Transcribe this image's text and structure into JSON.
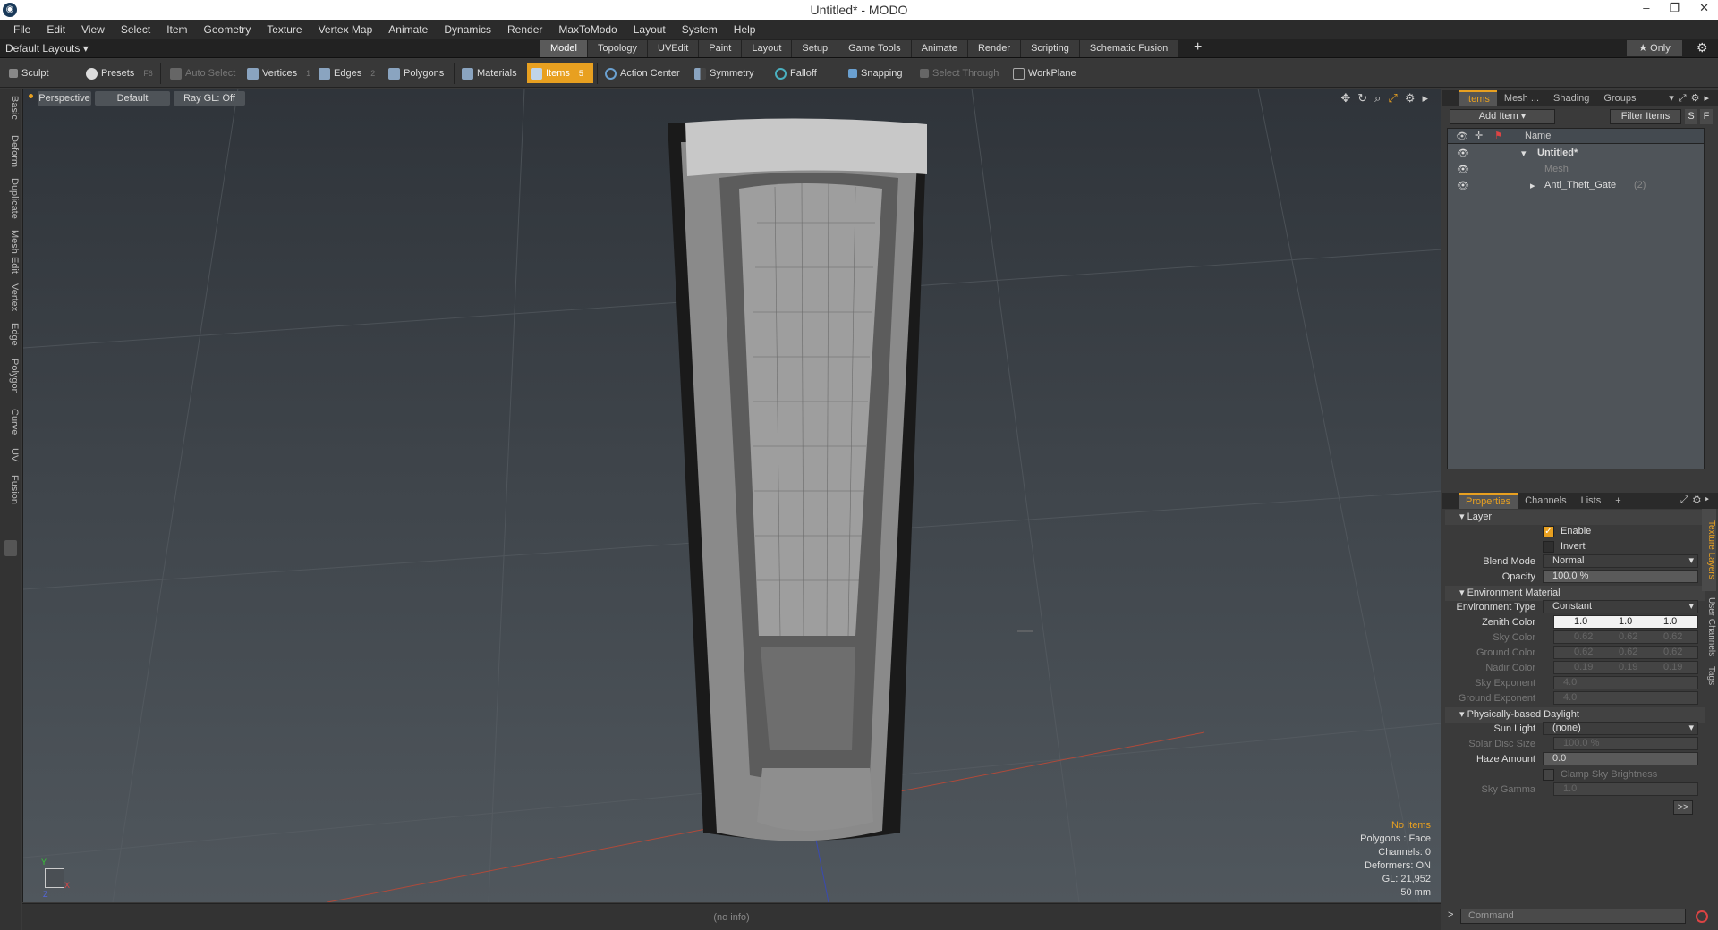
{
  "window": {
    "title": "Untitled* - MODO",
    "app_icon": "modo-logo-icon",
    "controls": [
      "–",
      "❐",
      "✕"
    ]
  },
  "menu": [
    "File",
    "Edit",
    "View",
    "Select",
    "Item",
    "Geometry",
    "Texture",
    "Vertex Map",
    "Animate",
    "Dynamics",
    "Render",
    "MaxToModo",
    "Layout",
    "System",
    "Help"
  ],
  "layouts": {
    "label": "Default Layouts ▾",
    "tabs": [
      "Model",
      "Topology",
      "UVEdit",
      "Paint",
      "Layout",
      "Setup",
      "Game Tools",
      "Animate",
      "Render",
      "Scripting",
      "Schematic Fusion"
    ],
    "active_tab": "Model",
    "add": "+",
    "only": "★  Only"
  },
  "toolbar": {
    "sculpt": "Sculpt",
    "presets": "Presets",
    "presets_key": "F6",
    "auto_select": "Auto Select",
    "vertices": "Vertices",
    "vertices_key": "1",
    "edges": "Edges",
    "edges_key": "2",
    "polygons": "Polygons",
    "materials": "Materials",
    "items": "Items",
    "items_key": "5",
    "action_center": "Action Center",
    "symmetry": "Symmetry",
    "falloff": "Falloff",
    "snapping": "Snapping",
    "select_through": "Select Through",
    "workplane": "WorkPlane"
  },
  "left_tabs": [
    "Basic",
    "Deform",
    "Duplicate",
    "Mesh Edit",
    "Vertex",
    "Edge",
    "Polygon",
    "Curve",
    "UV",
    "Fusion"
  ],
  "viewport": {
    "view": "Perspective",
    "shading": "Default",
    "raygl": "Ray GL: Off",
    "stats": {
      "no_items": "No Items",
      "polygons": "Polygons : Face",
      "channels": "Channels: 0",
      "deformers": "Deformers: ON",
      "gl": "GL: 21,952",
      "focal": "50 mm"
    },
    "axes": {
      "x": "X",
      "y": "Y",
      "z": "Z"
    }
  },
  "status": "(no info)",
  "items_panel": {
    "tabs": [
      "Items",
      "Mesh ...",
      "Shading",
      "Groups"
    ],
    "add_item": "Add Item",
    "filter": "Filter Items",
    "s": "S",
    "f": "F",
    "col_name": "Name",
    "rows": [
      {
        "label": "Untitled*"
      },
      {
        "label": "Mesh"
      },
      {
        "label": "Anti_Theft_Gate",
        "count": "(2)"
      }
    ]
  },
  "properties": {
    "tabs": [
      "Properties",
      "Channels",
      "Lists"
    ],
    "side_tabs": [
      "Texture Layers",
      "User Channels",
      "Tags"
    ],
    "layer": "Layer",
    "enable": "Enable",
    "invert": "Invert",
    "blend_mode_label": "Blend Mode",
    "blend_mode": "Normal",
    "opacity_label": "Opacity",
    "opacity": "100.0 %",
    "env_material": "Environment Material",
    "env_type_label": "Environment Type",
    "env_type": "Constant",
    "zenith_label": "Zenith Color",
    "zenith": [
      "1.0",
      "1.0",
      "1.0"
    ],
    "sky_label": "Sky Color",
    "sky": [
      "0.62",
      "0.62",
      "0.62"
    ],
    "ground_label": "Ground Color",
    "ground": [
      "0.62",
      "0.62",
      "0.62"
    ],
    "nadir_label": "Nadir Color",
    "nadir": [
      "0.19",
      "0.19",
      "0.19"
    ],
    "sky_exp_label": "Sky Exponent",
    "sky_exp": "4.0",
    "ground_exp_label": "Ground Exponent",
    "ground_exp": "4.0",
    "daylight": "Physically-based Daylight",
    "sun_label": "Sun Light",
    "sun": "(none)",
    "disc_label": "Solar Disc Size",
    "disc": "100.0 %",
    "haze_label": "Haze Amount",
    "haze": "0.0",
    "clamp": "Clamp Sky Brightness",
    "gamma_label": "Sky Gamma",
    "gamma": "1.0",
    "more": ">>"
  },
  "command": {
    "prompt": ">",
    "placeholder": "Command"
  },
  "colors": {
    "accent": "#e8a020",
    "viewport_top": "#2f343a",
    "viewport_bottom": "#50575d"
  }
}
